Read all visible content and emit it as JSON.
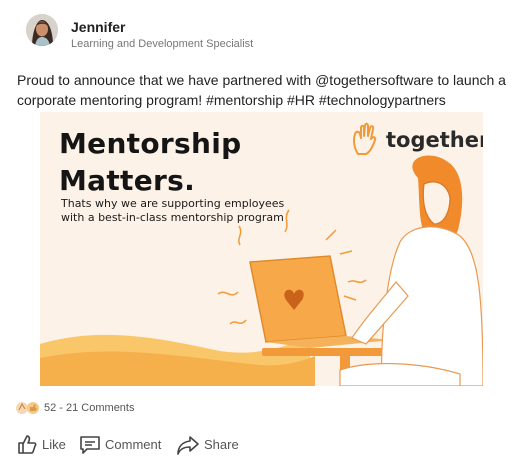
{
  "author": {
    "name": "Jennifer",
    "title": "Learning and Development Specialist"
  },
  "post": {
    "text": "Proud to announce that we have partnered with @togethersoftware to launch a corporate mentoring program! #mentorship #HR #technologypartners"
  },
  "banner": {
    "headline_line1": "Mentorship",
    "headline_line2": "Matters.",
    "subtitle_line1": "Thats why we are supporting employees",
    "subtitle_line2": "with a best-in-class mentorship program",
    "brand": "together",
    "brand_icon": "raised-hand-icon",
    "colors": {
      "background": "#fdf2e7",
      "accent": "#f7a94a",
      "accent_dark": "#e8862c"
    }
  },
  "engagement": {
    "reactions_text": "52 - 21 Comments",
    "reaction_icons": [
      "clap-icon",
      "thumbs-up-icon"
    ]
  },
  "actions": {
    "like": "Like",
    "comment": "Comment",
    "share": "Share"
  }
}
